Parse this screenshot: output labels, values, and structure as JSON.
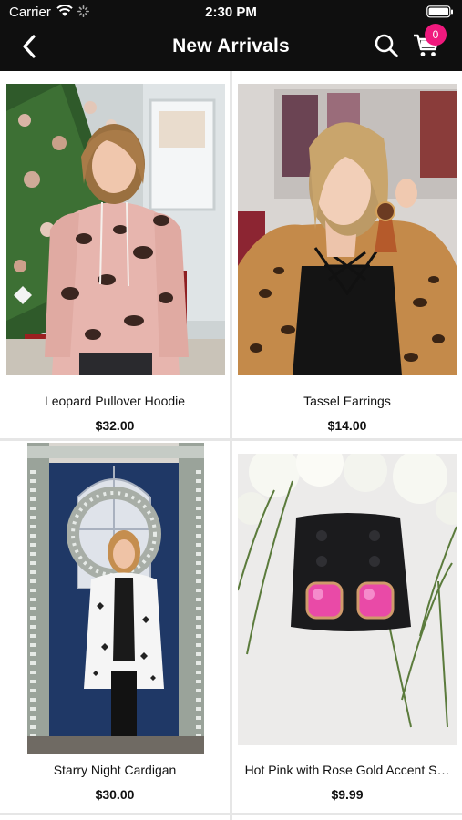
{
  "status": {
    "carrier": "Carrier",
    "time": "2:30 PM"
  },
  "nav": {
    "title": "New Arrivals",
    "cart_count": "0"
  },
  "products": [
    {
      "name": "Leopard Pullover Hoodie",
      "price": "$32.00"
    },
    {
      "name": "Tassel Earrings",
      "price": "$14.00"
    },
    {
      "name": "Starry Night Cardigan",
      "price": "$30.00"
    },
    {
      "name": "Hot Pink with Rose Gold Accent S…",
      "price": "$9.99"
    }
  ],
  "colors": {
    "bar": "#0f0f0f",
    "badge": "#f0197d",
    "divider": "#e6e6e6"
  },
  "icons": {
    "back": "chevron-left-icon",
    "search": "search-icon",
    "cart": "cart-icon"
  }
}
